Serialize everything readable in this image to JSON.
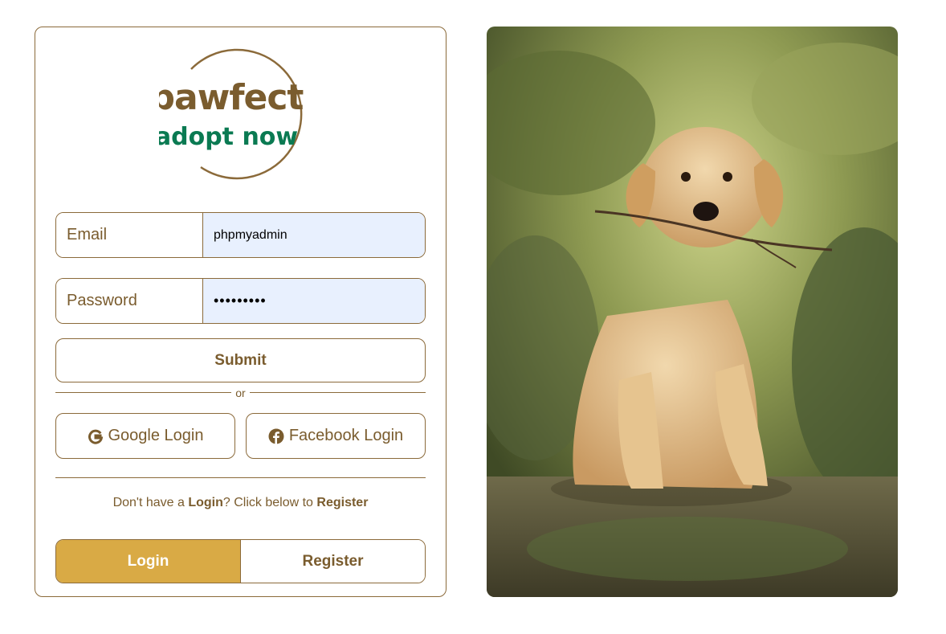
{
  "logo": {
    "brand": "pawfect",
    "tagline": "adopt now"
  },
  "form": {
    "email_label": "Email",
    "email_value": "phpmyadmin",
    "password_label": "Password",
    "password_value": "•••••••••",
    "submit_label": "Submit",
    "or_text": "or",
    "google_label": "Google Login",
    "facebook_label": "Facebook Login"
  },
  "note": {
    "prefix": "Don't have a ",
    "login_word": "Login",
    "middle": "? Click below to ",
    "register_word": "Register"
  },
  "tabs": {
    "login_label": "Login",
    "register_label": "Register"
  },
  "colors": {
    "brown": "#7a5c2e",
    "green": "#0a7a52",
    "gold": "#d9aa45",
    "input_bg": "#e8f0fe"
  },
  "icons": {
    "google": "google-g-icon",
    "facebook": "facebook-icon"
  }
}
